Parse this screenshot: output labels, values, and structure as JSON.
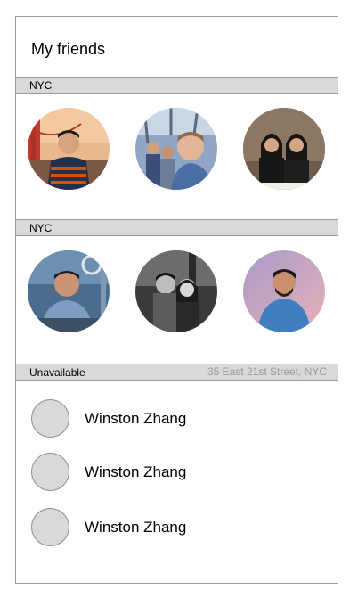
{
  "header": {
    "title": "My friends"
  },
  "sections": [
    {
      "label": "NYC",
      "friends": [
        {
          "icon": "friend-photo-golden-gate"
        },
        {
          "icon": "friend-photo-selfie"
        },
        {
          "icon": "friend-photo-two-women"
        }
      ]
    },
    {
      "label": "NYC",
      "friends": [
        {
          "icon": "friend-photo-man-blue-shirt"
        },
        {
          "icon": "friend-photo-couple-bw"
        },
        {
          "icon": "friend-photo-man-blue-tee"
        }
      ]
    }
  ],
  "unavailable": {
    "label": "Unavailable",
    "location": "35 East 21st Street, NYC",
    "items": [
      {
        "name": "Winston Zhang",
        "icon": "avatar-placeholder"
      },
      {
        "name": "Winston Zhang",
        "icon": "avatar-placeholder"
      },
      {
        "name": "Winston Zhang",
        "icon": "avatar-placeholder"
      }
    ]
  }
}
